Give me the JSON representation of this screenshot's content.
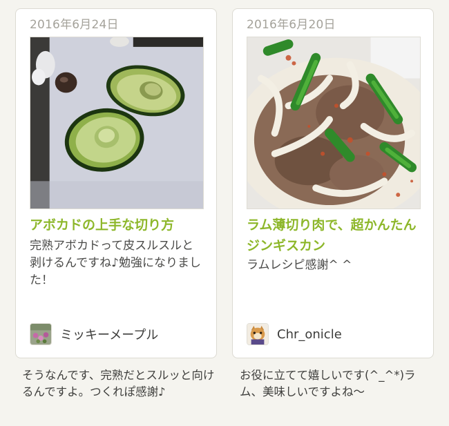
{
  "reports": [
    {
      "date": "2016年6月24日",
      "title": "アボカドの上手な切り方",
      "comment": "完熟アボカドって皮スルスルと剥けるんですね♪勉強になりました！",
      "author": "ミッキーメープル",
      "reply": "そうなんです、完熟だとスルッと向けるんですよ。つくれぽ感謝♪"
    },
    {
      "date": "2016年6月20日",
      "title": "ラム薄切り肉で、超かんたんジンギスカン",
      "comment": "ラムレシピ感謝^ ^",
      "author": "Chr_onicle",
      "reply": "お役に立てて嬉しいです(^_^*)ラム、美味しいですよね〜"
    }
  ],
  "colors": {
    "accent_title": "#8db72a",
    "date_text": "#a4a29a",
    "page_background": "#f5f4ef"
  }
}
